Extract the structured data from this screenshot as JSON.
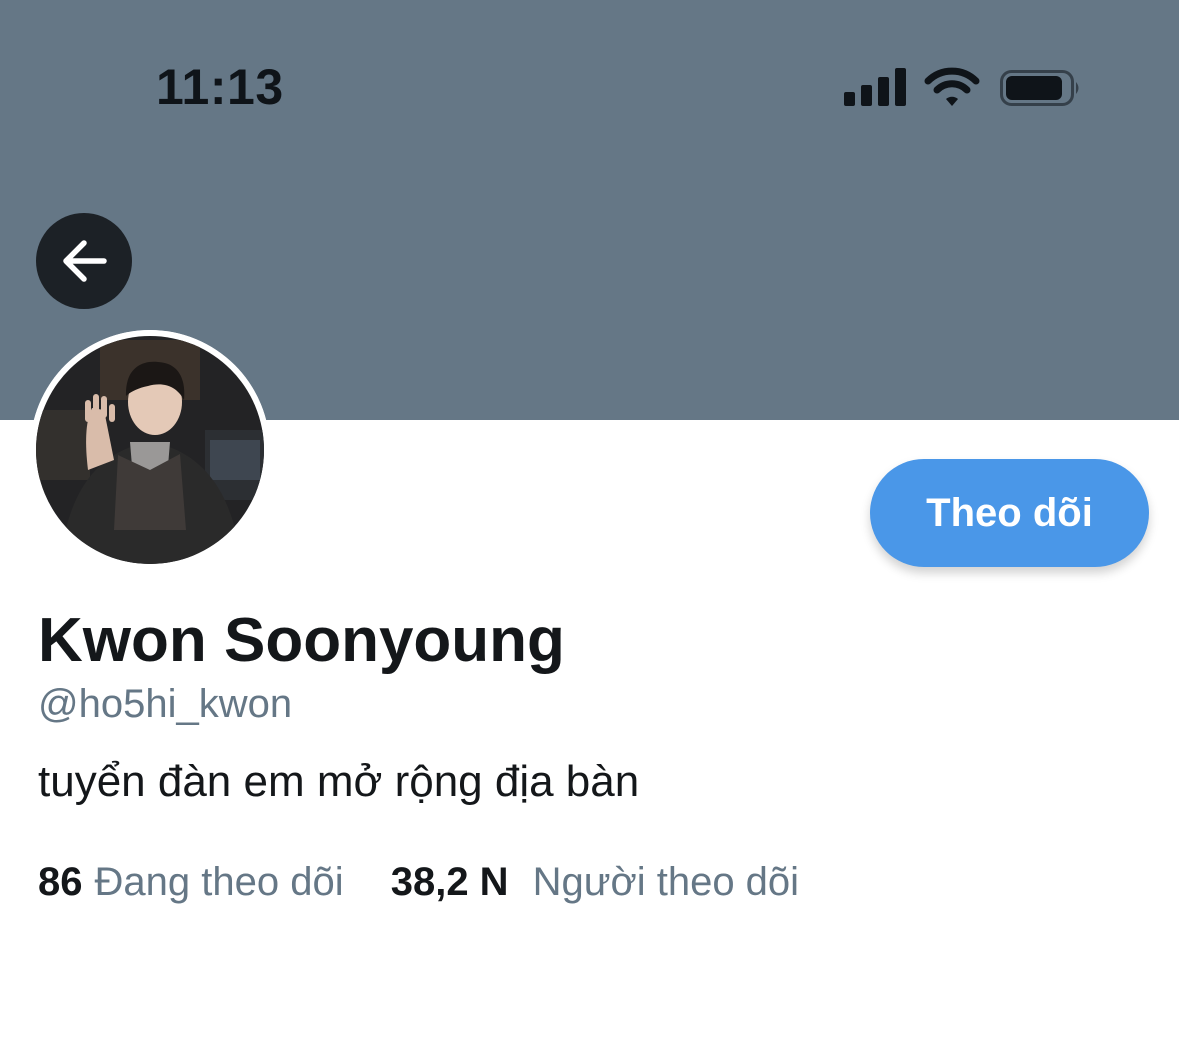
{
  "status_bar": {
    "time": "11:13",
    "icons": [
      "cellular-signal-icon",
      "wifi-icon",
      "battery-icon"
    ]
  },
  "header": {
    "banner_color": "#657786",
    "back_icon": "arrow-left-icon"
  },
  "profile": {
    "display_name": "Kwon Soonyoung",
    "handle": "@ho5hi_kwon",
    "bio": "tuyển đàn em mở rộng địa bàn",
    "follow_button_label": "Theo dõi",
    "following_count": "86",
    "following_label": "Đang theo dõi",
    "followers_count": "38,2 N",
    "followers_label": "Người theo dõi"
  },
  "colors": {
    "accent": "#4a97e8",
    "secondary_text": "#657786",
    "primary_text": "#14171a"
  }
}
